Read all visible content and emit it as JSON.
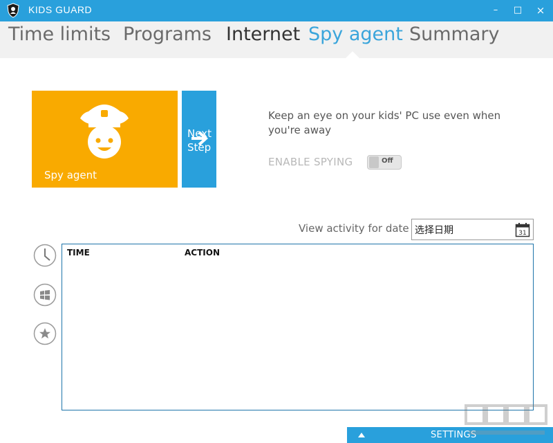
{
  "window": {
    "title": "KIDS GUARD",
    "controls": {
      "minimize": "–",
      "maximize": "□",
      "close": "×"
    },
    "accent_color": "#29a0dc"
  },
  "tabs": [
    {
      "label": "Time limits",
      "active": false
    },
    {
      "label": "Programs",
      "active": false
    },
    {
      "label": "Internet",
      "active": false
    },
    {
      "label": "Spy agent",
      "active": true
    },
    {
      "label": "Summary",
      "active": false
    }
  ],
  "tiles": {
    "main": {
      "label": "Spy agent",
      "icon": "police-officer-icon",
      "color": "#f9aa00"
    },
    "next": {
      "label": "Next Step",
      "icon": "arrow-right-icon",
      "color": "#29a0dc"
    }
  },
  "spy": {
    "description": "Keep an eye on your kids' PC use even when you're away",
    "enable_label": "ENABLE SPYING",
    "toggle_state": "Off"
  },
  "activity": {
    "label": "View activity for date",
    "date_value": "选择日期",
    "calendar_day": "31",
    "columns": [
      "TIME",
      "ACTION"
    ],
    "rows": []
  },
  "side_icons": [
    "clock-icon",
    "windows-icon",
    "star-icon"
  ],
  "footer": {
    "settings_label": "SETTINGS",
    "settings_icon": "triangle-up-icon"
  }
}
